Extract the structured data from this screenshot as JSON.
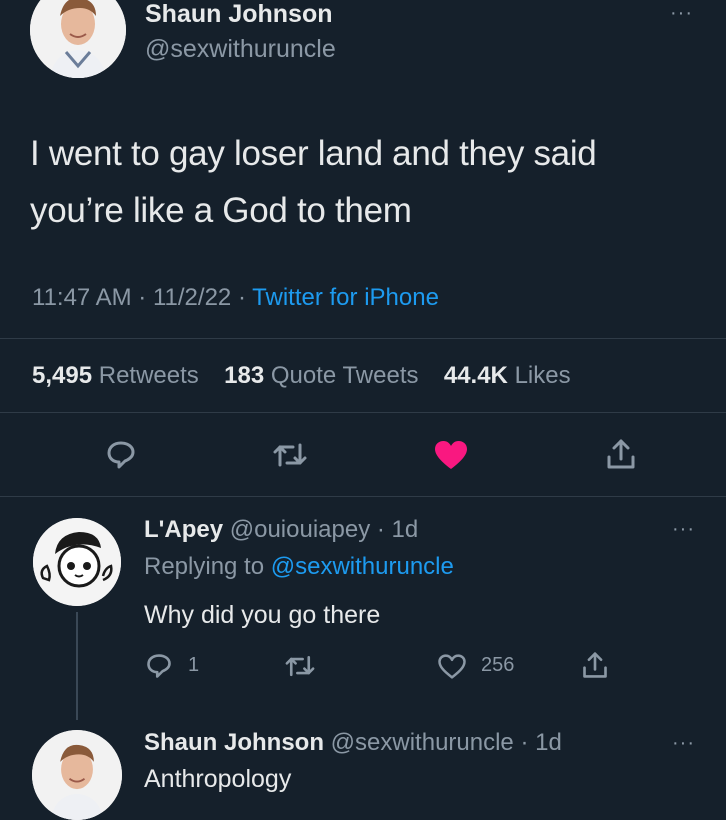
{
  "tweet": {
    "author_name": "Shaun Johnson",
    "author_handle": "@sexwithuruncle",
    "text_line1": "I went to gay loser land and they said",
    "text_line2": "you’re like a God to them",
    "time": "11:47 AM",
    "date": "11/2/22",
    "source": "Twitter for iPhone",
    "retweets_count": "5,495",
    "retweets_label": "Retweets",
    "quotes_count": "183",
    "quotes_label": "Quote Tweets",
    "likes_count": "44.4K",
    "likes_label": "Likes"
  },
  "reply1": {
    "author_name": "L'Apey",
    "author_handle": "@ouiouiapey",
    "age": "1d",
    "replying_to_label": "Replying to",
    "replying_to_handle": "@sexwithuruncle",
    "text": "Why did you go there",
    "reply_count": "1",
    "like_count": "256"
  },
  "reply2": {
    "author_name": "Shaun Johnson",
    "author_handle": "@sexwithuruncle",
    "age": "1d",
    "text": "Anthropology"
  },
  "colors": {
    "background": "#15202b",
    "accent": "#1d9bf0",
    "liked": "#f91880",
    "muted": "#8b98a5"
  },
  "icons": [
    "more-icon",
    "reply-icon",
    "retweet-icon",
    "heart-filled-icon",
    "share-icon",
    "heart-outline-icon"
  ]
}
